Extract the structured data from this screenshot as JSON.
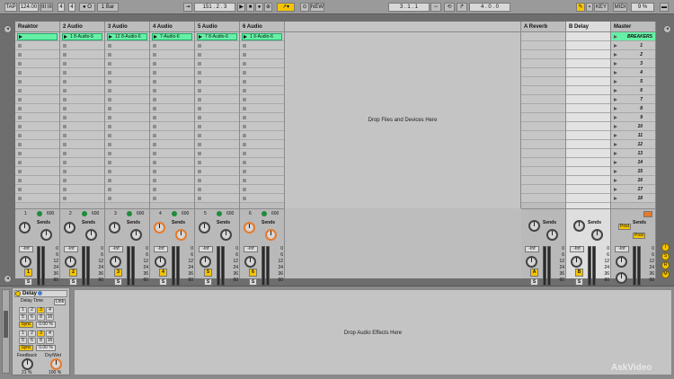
{
  "transport": {
    "tap": "TAP",
    "tempo": "124.00",
    "nudge": "III III",
    "sig_num": "4",
    "sig_den": "4",
    "metro": "● O",
    "quant": "1 Bar",
    "position": "151 . 2 . 3",
    "new": "NEW",
    "loop_start": "3 . 1 . 1",
    "loop_len": "4 . 0 . 0",
    "key": "KEY",
    "midi": "MIDI",
    "cpu": "9 %"
  },
  "tracks": [
    {
      "name": "Reaktor",
      "clip": "",
      "number": "1",
      "mix_label": "600"
    },
    {
      "name": "2 Audio",
      "clip": "1 8-Audio-6",
      "number": "2",
      "mix_label": "600"
    },
    {
      "name": "3 Audio",
      "clip": "12 8-Audio-6",
      "number": "3",
      "mix_label": "600"
    },
    {
      "name": "4 Audio",
      "clip": "7-Audio-6",
      "number": "4",
      "mix_label": "600"
    },
    {
      "name": "5 Audio",
      "clip": "7 8-Audio-6",
      "number": "5",
      "mix_label": "600"
    },
    {
      "name": "6 Audio",
      "clip": "1 9-Audio-6",
      "number": "6",
      "mix_label": "600"
    }
  ],
  "returns": [
    {
      "name": "A Reverb",
      "letter": "A"
    },
    {
      "name": "B Delay",
      "letter": "B"
    }
  ],
  "master": {
    "name": "Master",
    "scene_label": "BREAKERS",
    "scenes": [
      "1",
      "2",
      "3",
      "4",
      "5",
      "6",
      "7",
      "8",
      "9",
      "10",
      "11",
      "12",
      "13",
      "14",
      "15",
      "16",
      "17",
      "18"
    ],
    "post1": "Post",
    "post2": "Post"
  },
  "mixer_labels": {
    "sends": "Sends",
    "inf": "-Inf",
    "solo": "S",
    "scale": [
      "0",
      "6",
      "12",
      "24",
      "36",
      "60"
    ]
  },
  "drop_files": "Drop Files and Devices Here",
  "drop_effects": "Drop Audio Effects Here",
  "device": {
    "title": "Delay",
    "delay_time": "Delay Time",
    "link": "Link",
    "sync": "Sync",
    "pct1": "0.00 %",
    "pct2": "0.00 %",
    "grid_nums": [
      "1",
      "2",
      "3",
      "4",
      "5",
      "6",
      "8",
      "16"
    ],
    "feedback": "Feedback",
    "drywet": "Dry/Wet",
    "feedback_val": "21 %",
    "drywet_val": "100 %"
  },
  "watermark": "AskVideo"
}
